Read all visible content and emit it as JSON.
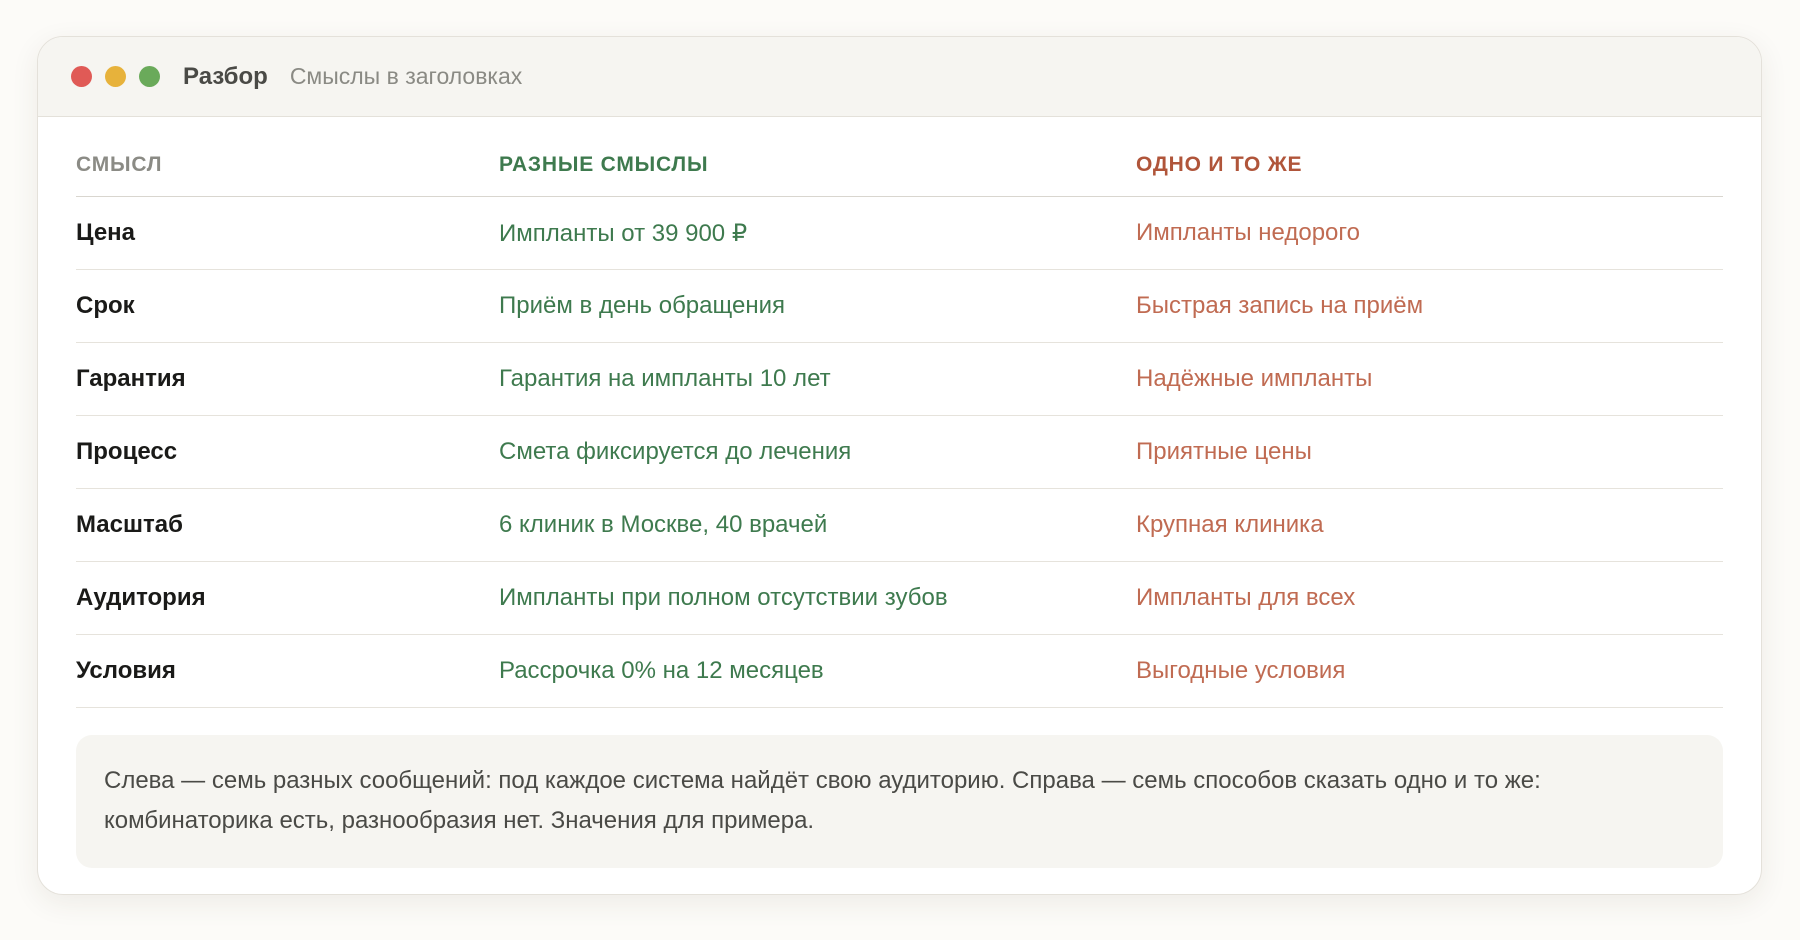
{
  "window": {
    "title": "Разбор",
    "subtitle": "Смыслы в заголовках",
    "controls": [
      "close",
      "minimize",
      "maximize"
    ]
  },
  "table": {
    "headers": [
      "Смысл",
      "Разные смыслы",
      "Одно и то же"
    ],
    "rows": [
      [
        "Цена",
        "Импланты от 39 900 ₽",
        "Импланты недорого"
      ],
      [
        "Срок",
        "Приём в день обращения",
        "Быстрая запись на приём"
      ],
      [
        "Гарантия",
        "Гарантия на импланты 10 лет",
        "Надёжные импланты"
      ],
      [
        "Процесс",
        "Смета фиксируется до лечения",
        "Приятные цены"
      ],
      [
        "Масштаб",
        "6 клиник в Москве, 40 врачей",
        "Крупная клиника"
      ],
      [
        "Аудитория",
        "Импланты при полном отсутствии зубов",
        "Импланты для всех"
      ],
      [
        "Условия",
        "Рассрочка 0% на 12 месяцев",
        "Выгодные условия"
      ]
    ]
  },
  "note": "Слева — семь разных сообщений: под каждое система найдёт свою аудиторию. Справа — семь способов сказать одно и то же: комбинаторика есть, разнообразия нет. Значения для примера.",
  "colors": {
    "close": "#e05a56",
    "minimize": "#e7b23b",
    "maximize": "#6aaa5a",
    "different_meanings": "#3e7a4e",
    "same_meaning": "#c06b52"
  }
}
